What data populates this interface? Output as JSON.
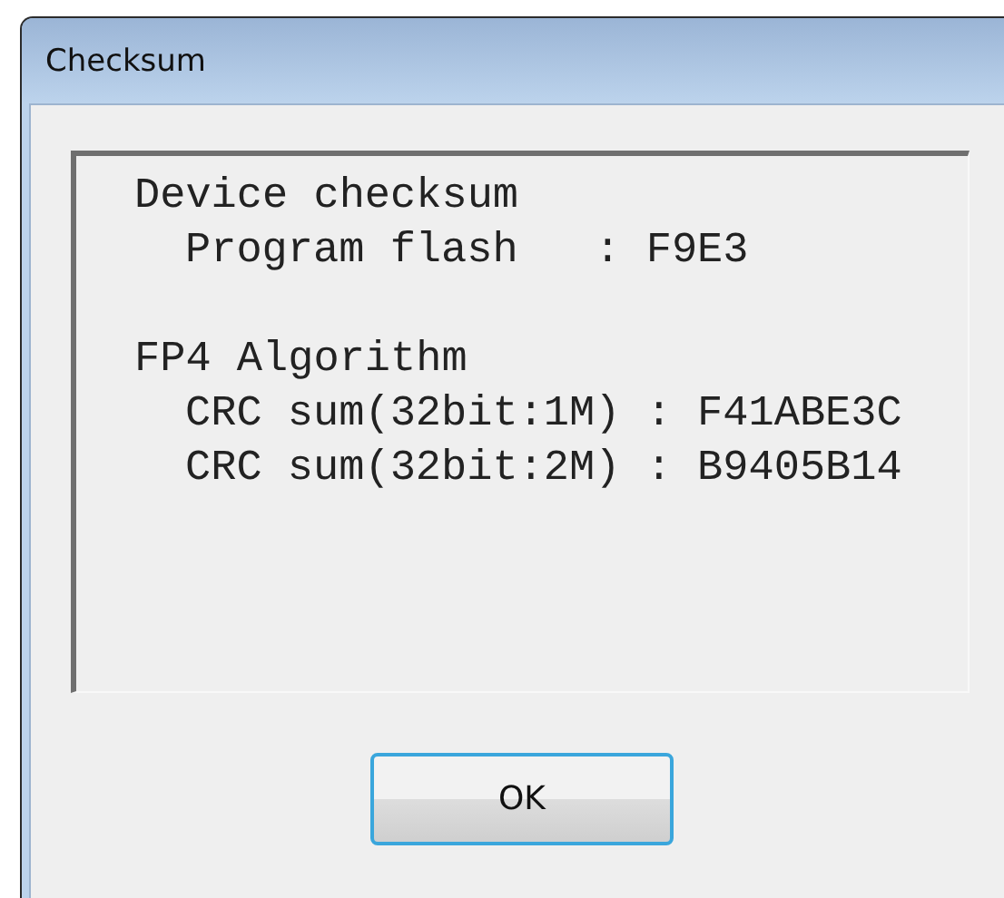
{
  "window": {
    "title": "Checksum"
  },
  "sections": [
    {
      "heading": "Device checksum",
      "lines": [
        "Program flash   : F9E3"
      ]
    },
    {
      "heading": "FP4 Algorithm",
      "lines": [
        "CRC sum(32bit:1M) : F41ABE3C",
        "CRC sum(32bit:2M) : B9405B14"
      ]
    }
  ],
  "buttons": [
    {
      "label": "OK",
      "focused": true
    }
  ]
}
